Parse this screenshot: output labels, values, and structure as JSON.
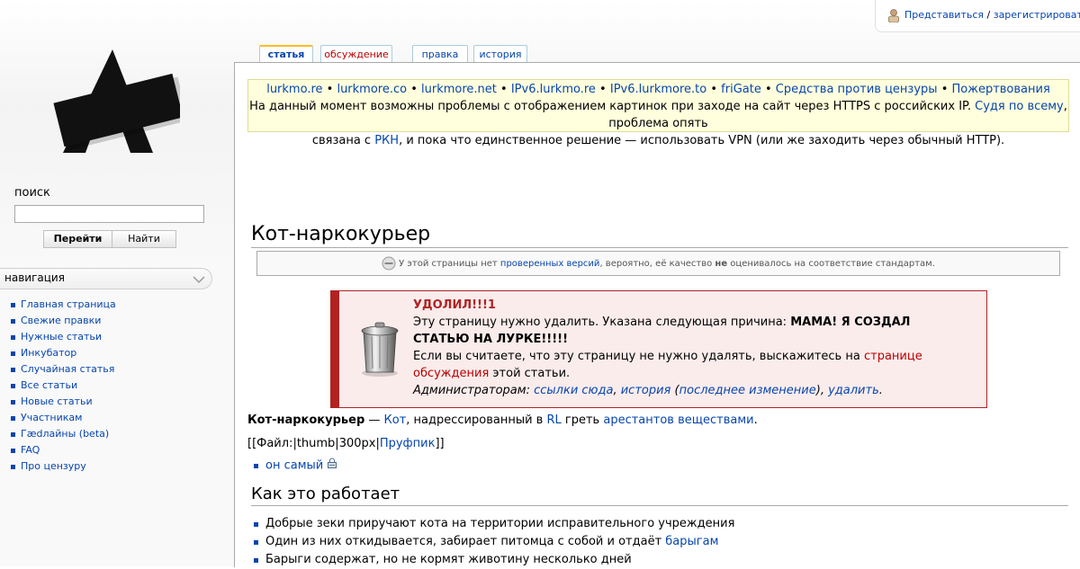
{
  "personal": {
    "login_label": "Представиться",
    "separator": " / ",
    "register_label": "зарегистрироваться"
  },
  "search": {
    "title": "поиск",
    "go_label": "Перейти",
    "fulltext_label": "Найти"
  },
  "navigation": {
    "title": "навигация",
    "items": [
      "Главная страница",
      "Свежие правки",
      "Нужные статьи",
      "Инкубатор",
      "Случайная статья",
      "Все статьи",
      "Новые статьи",
      "Участникам",
      "Гædлайны (beta)",
      "FAQ",
      "Про цензуру"
    ]
  },
  "tabs": {
    "article": "статья",
    "discussion": "обсуждение",
    "edit": "правка",
    "history": "история"
  },
  "sitenotice": {
    "mirror_links": [
      "lurkmo.re",
      "lurkmore.co",
      "lurkmore.net",
      "IPv6.lurkmo.re",
      "IPv6.lurkmore.to",
      "friGate",
      "Средства против цензуры",
      "Пожертвования"
    ],
    "bullet": " • ",
    "line2_text": "На данный момент возможны проблемы с отображением картинок при заходе на сайт через HTTPS с российских IP.",
    "line2_link": "Судя по всему",
    "line2_tail": ", проблема опять",
    "line3_pre": "связана с",
    "line3_link": "РКН",
    "line3_tail": ", и пока что единственное решение — использовать VPN (или же заходить через обычный HTTP)."
  },
  "page": {
    "title": "Кот-наркокурьер",
    "flagged_pre": "У этой страницы нет",
    "flagged_link": "проверенных версий",
    "flagged_mid": ", вероятно, её качество",
    "flagged_bold": "не",
    "flagged_post": "оценивалось на соответствие стандартам."
  },
  "delete_box": {
    "title": "УДОЛИЛ!!!1",
    "reason_pre": "Эту страницу нужно удалить. Указана следующая причина:",
    "reason": "МАМА! Я СОЗДАЛ СТАТЬЮ НА ЛУРКЕ!!!!!",
    "objection_pre": "Если вы считаете, что эту страницу не нужно удалять, выскажитесь на",
    "objection_link": "странице обсуждения",
    "objection_post": "этой статьи.",
    "admins_label": "Администраторам:",
    "link_whatlinks": "ссылки сюда",
    "link_history": "история",
    "link_lastchange": "последнее изменение",
    "link_delete": "удалить"
  },
  "intro": {
    "term": "Кот-наркокурьер",
    "dash": " — ",
    "link_cat": "Кот",
    "text1": ", надрессированный в",
    "link_rl": "RL",
    "text2": "греть",
    "link_prisoners": "арестантов веществами",
    "end": "."
  },
  "file_line": {
    "pre": "[[Файл:|thumb|300px|",
    "link": "Пруфпик",
    "post": "]]"
  },
  "external": {
    "label": "он самый"
  },
  "section_how": {
    "title": "Как это работает",
    "item1": "Добрые зеки приручают кота на территории исправительного учреждения",
    "item2_pre": "Один из них откидывается, забирает питомца с собой и отдаёт",
    "item2_link": "барыгам",
    "item3": "Барыги содержат, но не кормят животину несколько дней"
  }
}
